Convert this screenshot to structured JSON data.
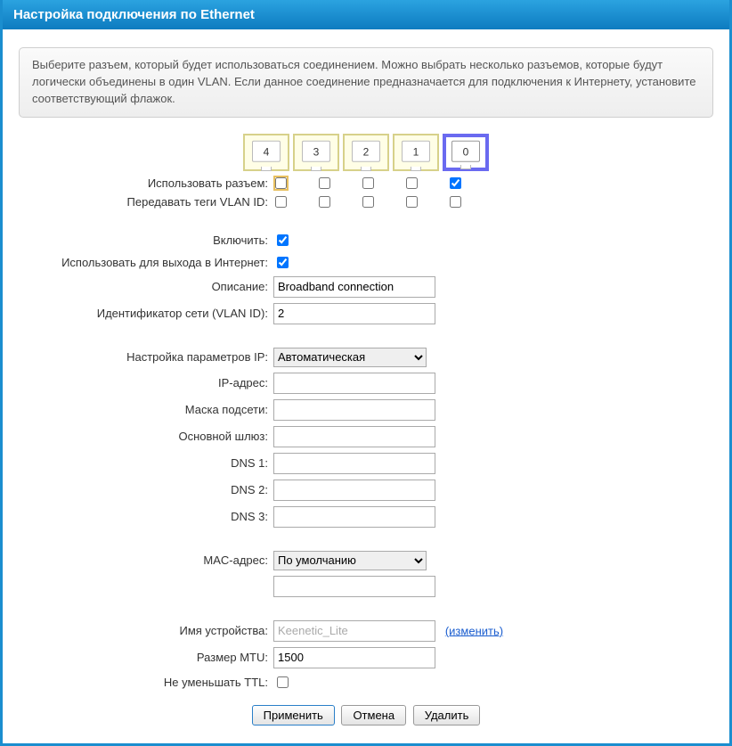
{
  "title": "Настройка подключения по Ethernet",
  "info": "Выберите разъем, который будет использоваться соединением. Можно выбрать несколько разъемов, которые будут логически объединены в один VLAN. Если данное соединение предназначается для подключения к Интернету, установите соответствующий флажок.",
  "ports": [
    "4",
    "3",
    "2",
    "1",
    "0"
  ],
  "labels": {
    "use_port": "Использовать разъем:",
    "vlan_tags": "Передавать теги VLAN ID:",
    "enable": "Включить:",
    "use_internet": "Использовать для выхода в Интернет:",
    "description": "Описание:",
    "vlan_id": "Идентификатор сети (VLAN ID):",
    "ip_settings": "Настройка параметров IP:",
    "ip": "IP-адрес:",
    "mask": "Маска подсети:",
    "gw": "Основной шлюз:",
    "dns1": "DNS 1:",
    "dns2": "DNS 2:",
    "dns3": "DNS 3:",
    "mac": "MAC-адрес:",
    "device_name": "Имя устройства:",
    "mtu": "Размер MTU:",
    "ttl": "Не уменьшать TTL:",
    "change": "(изменить)"
  },
  "values": {
    "description": "Broadband connection",
    "vlan_id": "2",
    "ip_settings": "Автоматическая",
    "ip": "",
    "mask": "",
    "gw": "",
    "dns1": "",
    "dns2": "",
    "dns3": "",
    "mac": "По умолчанию",
    "mac_custom": "",
    "device_name": "Keenetic_Lite",
    "mtu": "1500"
  },
  "checkboxes": {
    "use_port": [
      false,
      false,
      false,
      false,
      true
    ],
    "vlan_tags": [
      false,
      false,
      false,
      false,
      false
    ],
    "enable": true,
    "use_internet": true,
    "ttl": false
  },
  "buttons": {
    "apply": "Применить",
    "cancel": "Отмена",
    "delete": "Удалить"
  }
}
